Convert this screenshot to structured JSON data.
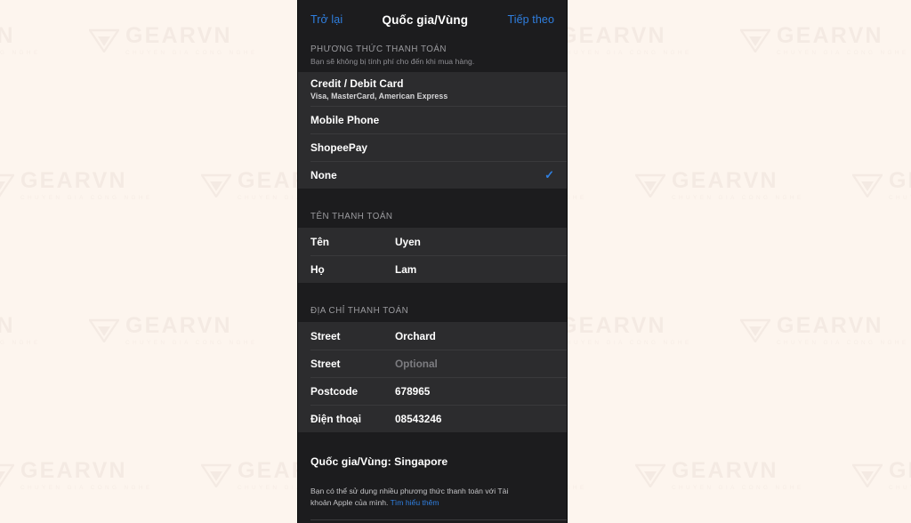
{
  "background": {
    "color": "#fdf5ee",
    "watermark": {
      "name": "GEARVN",
      "tagline": "CHUYEN GIA CONG NGHE",
      "icon": "gearvn-triangle-logo"
    }
  },
  "phone": {
    "screen_bg": "#1c1c1e",
    "row_bg": "#2c2c2e",
    "accent": "#2f7fe0"
  },
  "nav": {
    "back_label": "Trở lại",
    "title": "Quốc gia/Vùng",
    "next_label": "Tiếp theo"
  },
  "payment_section": {
    "header": "PHƯƠNG THỨC THANH TOÁN",
    "subheader": "Bạn sẽ không bị tính phí cho đến khi mua hàng.",
    "options": [
      {
        "label": "Credit / Debit Card",
        "sublabel": "Visa, MasterCard, American Express",
        "selected": false
      },
      {
        "label": "Mobile Phone",
        "sublabel": "",
        "selected": false
      },
      {
        "label": "ShopeePay",
        "sublabel": "",
        "selected": false
      },
      {
        "label": "None",
        "sublabel": "",
        "selected": true,
        "check_glyph": "✓"
      }
    ]
  },
  "billing_name_section": {
    "header": "TÊN THANH TOÁN",
    "fields": [
      {
        "label": "Tên",
        "value": "Uyen",
        "is_placeholder": false
      },
      {
        "label": "Họ",
        "value": "Lam",
        "is_placeholder": false
      }
    ]
  },
  "billing_address_section": {
    "header": "ĐỊA CHỈ THANH TOÁN",
    "fields": [
      {
        "label": "Street",
        "value": "Orchard",
        "is_placeholder": false
      },
      {
        "label": "Street",
        "value": "Optional",
        "is_placeholder": true
      },
      {
        "label": "Postcode",
        "value": "678965",
        "is_placeholder": false
      },
      {
        "label": "Điện thoại",
        "value": "08543246",
        "is_placeholder": false
      }
    ]
  },
  "footer": {
    "country_line": "Quốc gia/Vùng: Singapore",
    "note_text": "Bạn có thể sử dụng nhiều phương thức thanh toán với Tài khoản Apple của mình. ",
    "note_link": "Tìm hiểu thêm"
  }
}
